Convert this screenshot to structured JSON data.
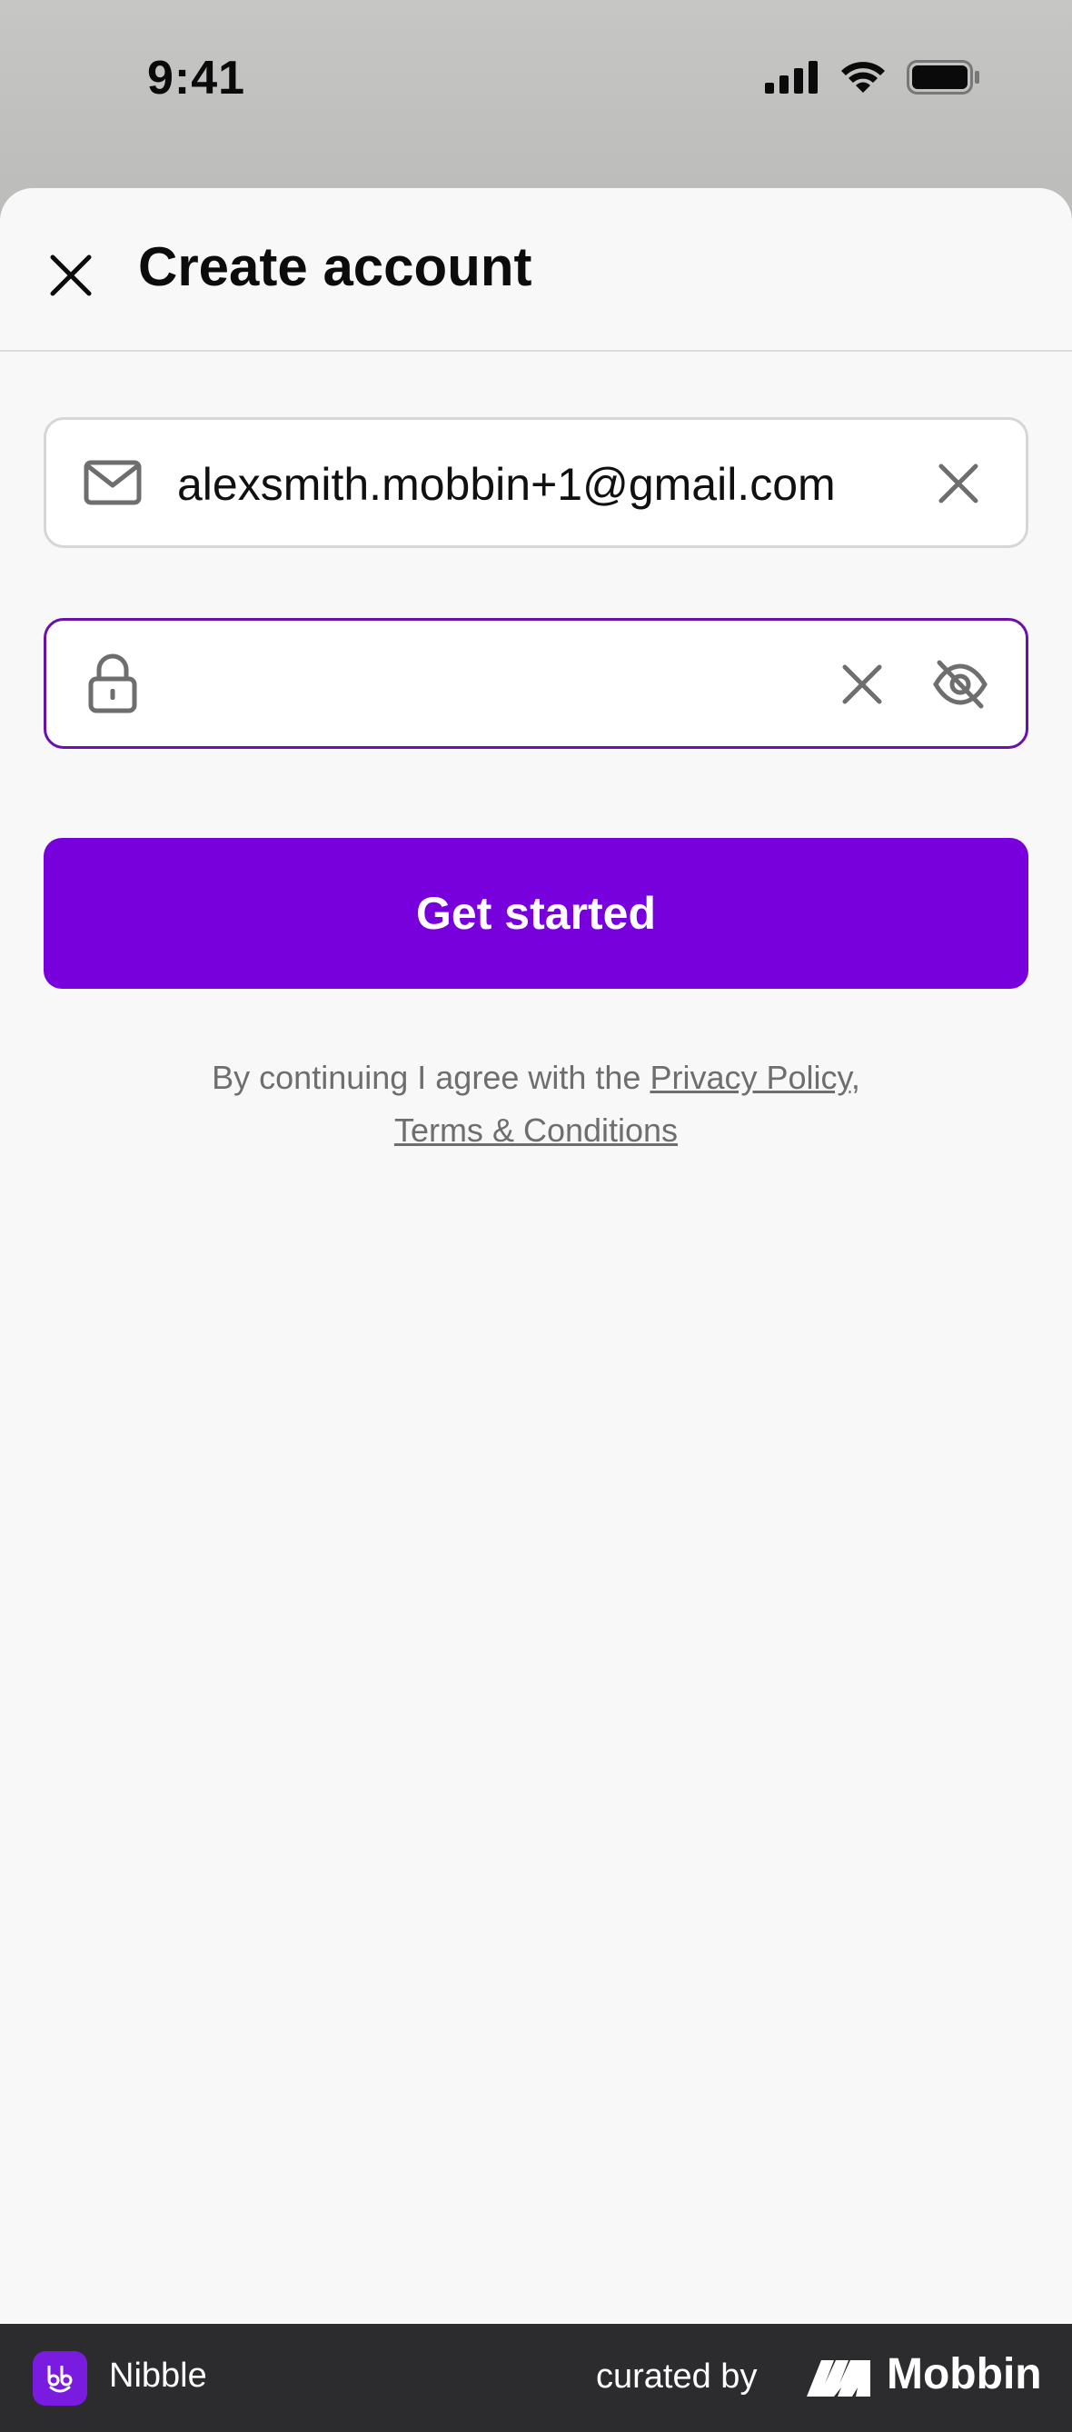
{
  "status_bar": {
    "time": "9:41",
    "icons": [
      "cellular-signal-icon",
      "wifi-icon",
      "battery-icon"
    ]
  },
  "header": {
    "title": "Create account",
    "close_icon": "close-icon"
  },
  "email_field": {
    "icon": "envelope-icon",
    "value": "alexsmith.mobbin+1@gmail.com",
    "clear_icon": "clear-icon"
  },
  "password_field": {
    "icon": "lock-icon",
    "value": "",
    "placeholder": "",
    "clear_icon": "clear-icon",
    "visibility_icon": "eye-off-icon",
    "focused": true
  },
  "primary_button": {
    "label": "Get started"
  },
  "legal": {
    "prefix": "By continuing I agree with the",
    "privacy_link": "Privacy Policy,",
    "terms_link": "Terms & Conditions"
  },
  "footer": {
    "app_name": "Nibble",
    "curated_by": "curated by",
    "brand": "Mobbin"
  },
  "colors": {
    "accent": "#7700dd",
    "focus_border": "#6a11a8",
    "background": "#f8f8f8",
    "footer_bg": "#2c2c2e"
  }
}
